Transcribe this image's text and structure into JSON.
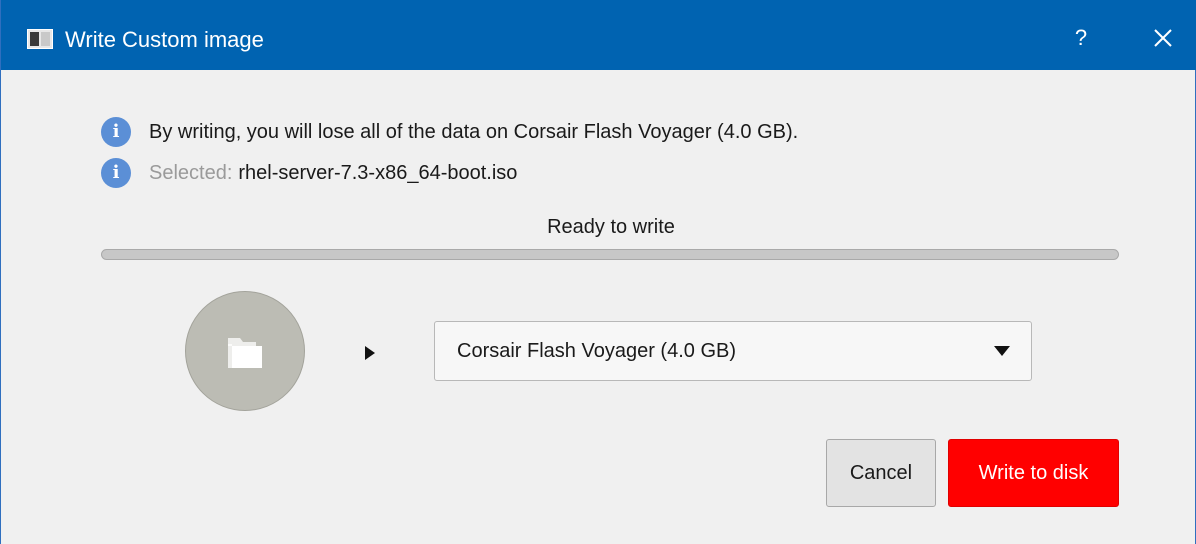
{
  "window": {
    "title": "Write Custom image",
    "help_label": "?",
    "titlebar_color": "#0063b1"
  },
  "info": {
    "warning": "By writing, you will lose all of the data on Corsair Flash Voyager (4.0 GB).",
    "selected_label": "Selected:",
    "selected_file": "rhel-server-7.3-x86_64-boot.iso",
    "info_icon": "info-icon"
  },
  "status": {
    "label": "Ready to write",
    "progress": 0
  },
  "source": {
    "icon": "folder-icon"
  },
  "target": {
    "selected": "Corsair Flash Voyager (4.0 GB)"
  },
  "buttons": {
    "cancel": "Cancel",
    "write": "Write to disk",
    "write_color": "#ff0000"
  }
}
